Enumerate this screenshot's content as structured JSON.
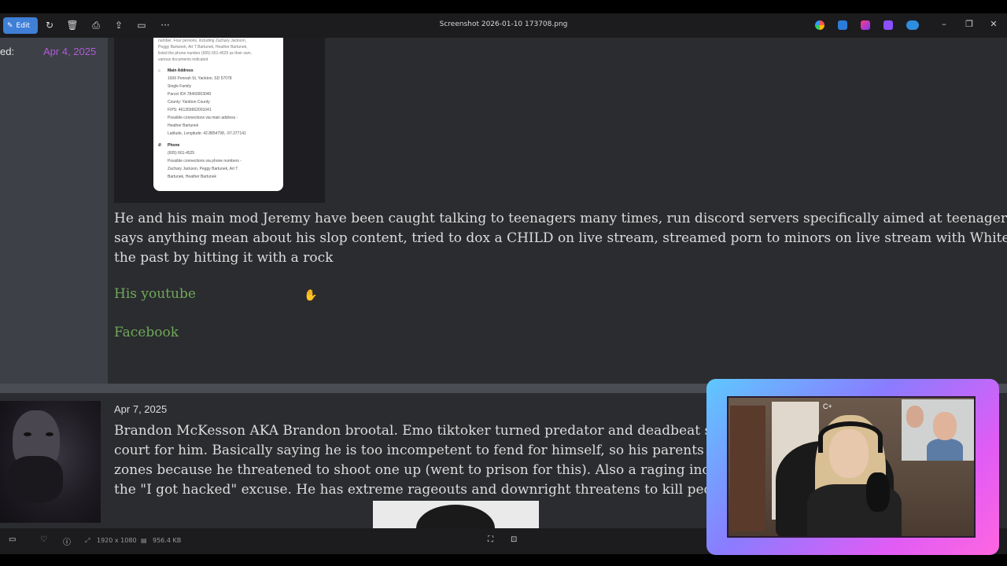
{
  "toolbar": {
    "edit_label": "Edit",
    "title": "Screenshot 2026-01-10 173708.png",
    "icons": [
      "rotate-icon",
      "delete-icon",
      "print-icon",
      "share-icon",
      "slideshow-icon",
      "more-icon"
    ]
  },
  "post1": {
    "label_partial": "ed:",
    "date": "Apr 4, 2025",
    "screenshot_text": {
      "top_lines": [
        "number. Four persons, including Zachary Jackson,",
        "Peggy Bartunek, Art T Bartunek, Heather Bartunek,",
        "listed the phone number (605) 661-4525 as their own,",
        "various documents indicated"
      ],
      "address_heading": "Main Address",
      "address_lines": [
        "1606 Pennah St, Yankton, SD 57078",
        "Single Family",
        "Parcel ID# 78460003040",
        "County: Yankton County",
        "FIPS: 461359662001041",
        "Possible connections via main address -",
        "Heather Bartunek",
        "Latitude, Longitude: 42.8854798, -97.377141"
      ],
      "phone_heading": "Phone",
      "phone_lines": [
        "(605) 661-4525",
        "Possible connections via phone numbers -",
        "Zachary Jackson, Peggy Bartunek, Art T",
        "Bartunek, Heather Bartunek"
      ]
    },
    "body_lines": [
      "He and his main mod Jeremy have been caught talking to teenagers many times, run discord servers specifically aimed at teenagers, attempt to",
      "says anything mean about his slop content, tried to dox a CHILD on live stream, streamed porn to minors on live stream with WhiteBowser on s",
      "the past by hitting it with a rock"
    ],
    "link_youtube": "His youtube",
    "link_facebook": "Facebook"
  },
  "post2": {
    "date": "Apr 7, 2025",
    "body_lines": [
      "Brandon McKesson AKA Brandon brootal. Emo tiktoker turned predator and deadbeat son. Trie",
      "court for him. Basically saying he is too incompetent to fend for himself, so his parents can have",
      "zones because he threatened to shoot one up (went to prison for this). Also a raging incel intent",
      "the \"I got hacked\" excuse. He has extreme rageouts and downright threatens to kill people who"
    ]
  },
  "statusbar": {
    "dimensions": "1920 x 1080",
    "filesize": "956.4 KB"
  },
  "webcam": {
    "overlay_text": "C+"
  },
  "colors": {
    "accent": "#3f7fd6",
    "date_purple": "#b05ad9",
    "link_green": "#6fa85a",
    "panel_bg": "#2b2c2f"
  }
}
